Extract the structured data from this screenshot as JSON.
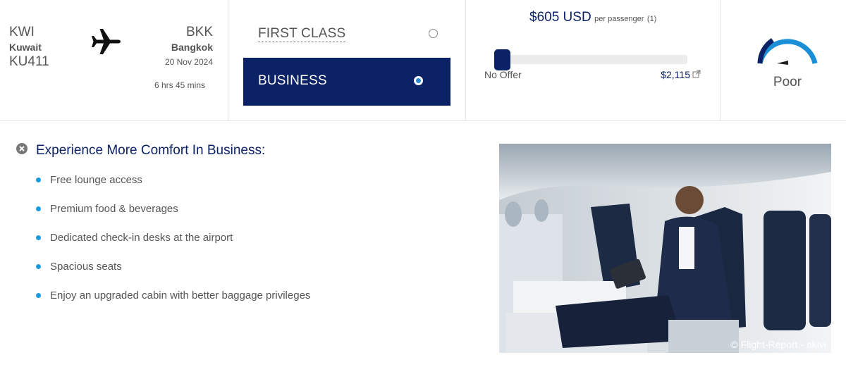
{
  "flight": {
    "origin_code": "KWI",
    "origin_city": "Kuwait",
    "flight_number": "KU411",
    "dest_code": "BKK",
    "dest_city": "Bangkok",
    "date": "20 Nov 2024",
    "duration": "6 hrs 45 mins",
    "plane_icon": "airplane-icon"
  },
  "cabin_options": [
    {
      "label": "FIRST CLASS",
      "selected": false
    },
    {
      "label": "BUSINESS",
      "selected": true
    }
  ],
  "offer": {
    "price": "$605 USD",
    "per_passenger": "per passenger",
    "passenger_count": "(1)",
    "min_label": "No Offer",
    "max_label": "$2,115",
    "slider_fraction": 0.0
  },
  "rating": {
    "label": "Poor",
    "gauge_fraction": 0.12
  },
  "upgrade": {
    "heading": "Experience More Comfort In Business:",
    "benefits": [
      "Free lounge access",
      "Premium food & beverages",
      "Dedicated check-in desks at the airport",
      "Spacious seats",
      "Enjoy an upgraded cabin with better baggage privileges"
    ],
    "photo_credit": "© Flight-Report - akivi"
  },
  "colors": {
    "brand_navy": "#0c2266",
    "bullet_blue": "#1a9be0",
    "gauge_blue": "#1b8fd6"
  }
}
